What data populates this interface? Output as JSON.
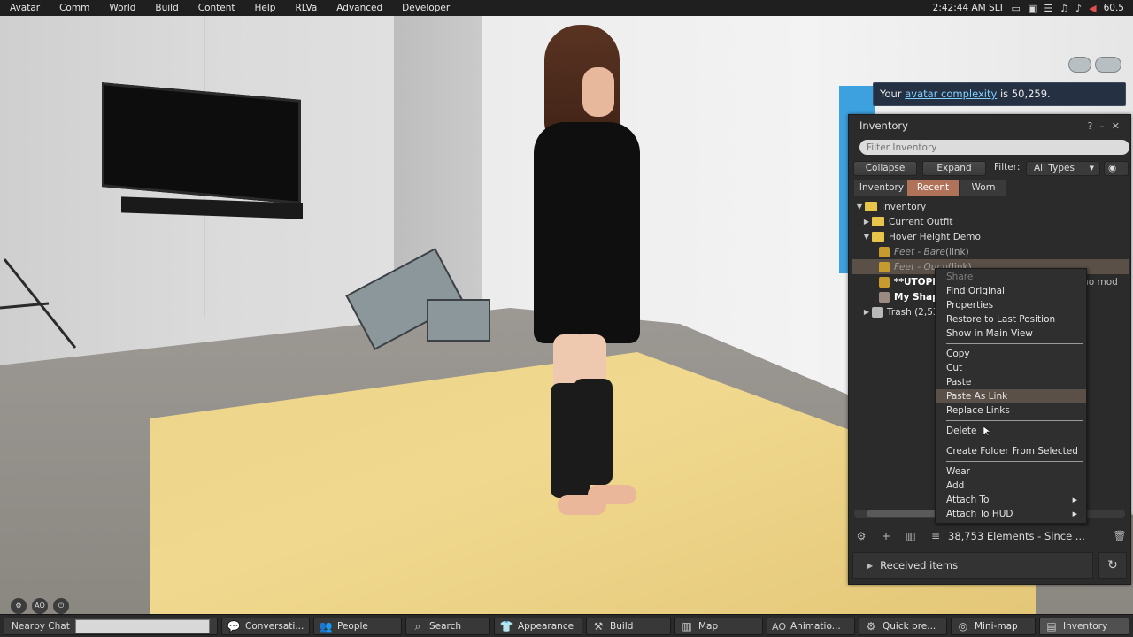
{
  "menubar": {
    "items": [
      "Avatar",
      "Comm",
      "World",
      "Build",
      "Content",
      "Help",
      "RLVa",
      "Advanced",
      "Developer"
    ],
    "time": "2:42:44 AM SLT",
    "fps": "60.5"
  },
  "toast": {
    "prefix": "Your ",
    "link": "avatar complexity",
    "suffix": " is 50,259."
  },
  "inventory": {
    "title": "Inventory",
    "filter_placeholder": "Filter Inventory",
    "collapse": "Collapse",
    "expand": "Expand",
    "filter_label": "Filter:",
    "filter_value": "All Types",
    "tabs": [
      "Inventory",
      "Recent",
      "Worn"
    ],
    "active_tab": "Recent",
    "tree": [
      {
        "label": "Inventory"
      },
      {
        "label": "Current Outfit"
      },
      {
        "label": "Hover Height Demo"
      },
      {
        "label": "Feet - Bare",
        "suffix": " (link)"
      },
      {
        "label": "Feet - Ouch",
        "suffix": " (link)"
      },
      {
        "label": "**UTOPI"
      },
      {
        "label": "My Shap"
      },
      {
        "label": "Trash (2,53"
      }
    ],
    "truncated_right": "(no mod",
    "element_count": "38,753 Elements - Since ...",
    "received": "Received items"
  },
  "context_menu": {
    "items": [
      "Share",
      "Find Original",
      "Properties",
      "Restore to Last Position",
      "Show in Main View",
      "Copy",
      "Cut",
      "Paste",
      "Paste As Link",
      "Replace Links",
      "Delete",
      "Create Folder From Selected",
      "Wear",
      "Add",
      "Attach To",
      "Attach To HUD"
    ],
    "highlighted": "Paste As Link"
  },
  "bottom_toolbar": {
    "nearby_chat": "Nearby Chat",
    "buttons": [
      "Conversati...",
      "People",
      "Search",
      "Appearance",
      "Build",
      "Map",
      "Animatio...",
      "Quick pre...",
      "Mini-map",
      "Inventory"
    ],
    "ao_label": "AO"
  }
}
